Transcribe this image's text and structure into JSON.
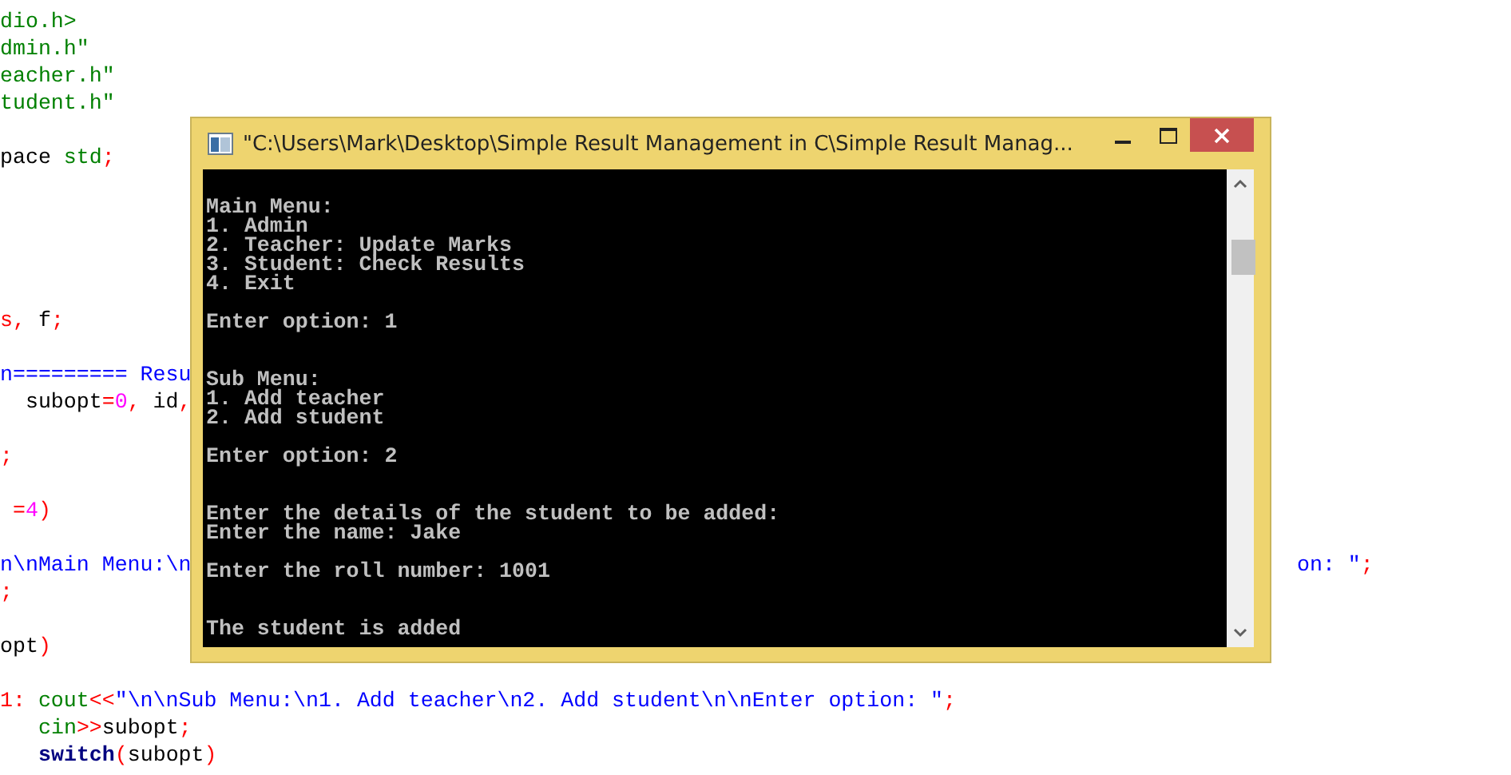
{
  "editor": {
    "lines": [
      {
        "kind": "code",
        "parts": [
          {
            "kind": "string",
            "text": "dio.h>"
          }
        ]
      },
      {
        "kind": "code",
        "parts": [
          {
            "kind": "string",
            "text": "dmin.h\""
          }
        ]
      },
      {
        "kind": "code",
        "parts": [
          {
            "kind": "string",
            "text": "eacher.h\""
          }
        ]
      },
      {
        "kind": "code",
        "parts": [
          {
            "kind": "string",
            "text": "tudent.h\""
          }
        ]
      },
      {
        "kind": "blank"
      },
      {
        "kind": "code",
        "parts": [
          {
            "kind": "plain",
            "text": "pace "
          },
          {
            "kind": "keyword",
            "text": "std"
          },
          {
            "kind": "op",
            "text": ";"
          }
        ]
      },
      {
        "kind": "blank"
      },
      {
        "kind": "blank"
      },
      {
        "kind": "blank"
      },
      {
        "kind": "blank"
      },
      {
        "kind": "blank"
      },
      {
        "kind": "code",
        "parts": [
          {
            "kind": "op",
            "text": "s, "
          },
          {
            "kind": "plain",
            "text": "f"
          },
          {
            "kind": "op",
            "text": ";"
          }
        ]
      },
      {
        "kind": "blank"
      },
      {
        "kind": "code",
        "parts": [
          {
            "kind": "literal",
            "text": "n========= Resu"
          }
        ]
      },
      {
        "kind": "code",
        "parts": [
          {
            "kind": "plain",
            "text": "  subopt"
          },
          {
            "kind": "op",
            "text": "="
          },
          {
            "kind": "number",
            "text": "0"
          },
          {
            "kind": "op",
            "text": ", "
          },
          {
            "kind": "plain",
            "text": "id"
          },
          {
            "kind": "op",
            "text": ","
          }
        ]
      },
      {
        "kind": "blank"
      },
      {
        "kind": "code",
        "parts": [
          {
            "kind": "op",
            "text": ";"
          }
        ]
      },
      {
        "kind": "blank"
      },
      {
        "kind": "code",
        "parts": [
          {
            "kind": "op",
            "text": " ="
          },
          {
            "kind": "number",
            "text": "4"
          },
          {
            "kind": "op",
            "text": ")"
          }
        ]
      },
      {
        "kind": "blank"
      },
      {
        "kind": "code",
        "parts": [
          {
            "kind": "literal",
            "text": "n\\nMain Menu:\\n"
          },
          {
            "kind": "tail",
            "text": "on: \""
          },
          {
            "kind": "op",
            "text": ";"
          }
        ]
      },
      {
        "kind": "code",
        "parts": [
          {
            "kind": "op",
            "text": ";"
          }
        ]
      },
      {
        "kind": "blank"
      },
      {
        "kind": "code",
        "parts": [
          {
            "kind": "plain",
            "text": "opt"
          },
          {
            "kind": "op",
            "text": ")"
          }
        ]
      },
      {
        "kind": "blank"
      },
      {
        "kind": "code",
        "parts": [
          {
            "kind": "op",
            "text": "1: "
          },
          {
            "kind": "keyword",
            "text": "cout"
          },
          {
            "kind": "op",
            "text": "<<"
          },
          {
            "kind": "literal",
            "text": "\"\\n\\nSub Menu:\\n1. Add teacher\\n2. Add student\\n\\nEnter option: \""
          },
          {
            "kind": "op",
            "text": ";"
          }
        ]
      },
      {
        "kind": "indented",
        "parts": [
          {
            "kind": "keyword",
            "text": "cin"
          },
          {
            "kind": "op",
            "text": ">>"
          },
          {
            "kind": "plain",
            "text": "subopt"
          },
          {
            "kind": "op",
            "text": ";"
          }
        ]
      },
      {
        "kind": "indented",
        "parts": [
          {
            "kind": "type",
            "text": "switch"
          },
          {
            "kind": "op",
            "text": "("
          },
          {
            "kind": "plain",
            "text": "subopt"
          },
          {
            "kind": "op",
            "text": ")"
          }
        ]
      }
    ]
  },
  "console": {
    "title": "\"C:\\Users\\Mark\\Desktop\\Simple Result Management in C\\Simple Result Manag...",
    "blocks": [
      {
        "kind": "paragraph",
        "lines": [
          "Main Menu:",
          "1. Admin",
          "2. Teacher: Update Marks",
          "3. Student: Check Results",
          "4. Exit"
        ]
      },
      {
        "kind": "paragraph",
        "lines": [
          "Enter option: 1"
        ]
      },
      {
        "kind": "section",
        "lines": [
          "Sub Menu:",
          "1. Add teacher",
          "2. Add student"
        ]
      },
      {
        "kind": "paragraph",
        "lines": [
          "Enter option: 2"
        ]
      },
      {
        "kind": "section",
        "lines": [
          "Enter the details of the student to be added:",
          "Enter the name: Jake"
        ]
      },
      {
        "kind": "paragraph",
        "lines": [
          "Enter the roll number: 1001"
        ]
      },
      {
        "kind": "section",
        "lines": [
          "The student is added"
        ]
      }
    ]
  }
}
